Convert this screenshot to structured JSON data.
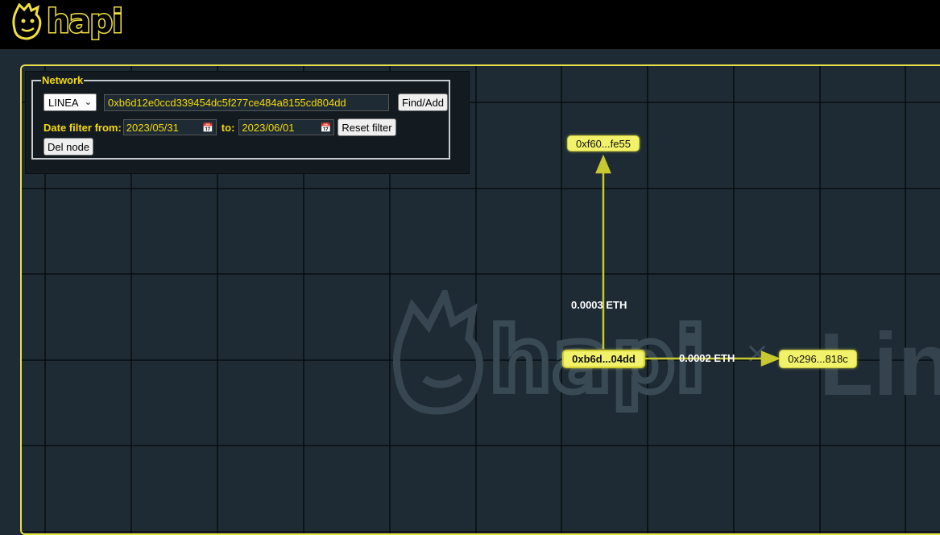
{
  "brand": {
    "logo_text": "hapi",
    "partner_text": "Lin",
    "separator": "×"
  },
  "colors": {
    "accent": "#f5d90a",
    "node_fill": "#f2f26a",
    "edge": "#c8c830",
    "background": "#1e2b34"
  },
  "panel": {
    "legend": "Network",
    "network_select": {
      "value": "LINEA"
    },
    "address_input": {
      "value": "0xb6d12e0ccd339454dc5f277ce484a8155cd804dd"
    },
    "find_add_label": "Find/Add",
    "date_from_label": "Date filter from:",
    "date_from_value": "2023/05/31",
    "date_to_label": "to:",
    "date_to_value": "2023/06/01",
    "reset_filter_label": "Reset filter",
    "del_node_label": "Del node"
  },
  "graph": {
    "nodes": [
      {
        "id": "top",
        "label": "0xf60...fe55"
      },
      {
        "id": "center",
        "label": "0xb6d...04dd"
      },
      {
        "id": "right",
        "label": "0x296...818c"
      }
    ],
    "edges": [
      {
        "from": "center",
        "to": "top",
        "label": "0.0003 ETH"
      },
      {
        "from": "center",
        "to": "right",
        "label": "0.0002 ETH"
      }
    ]
  }
}
